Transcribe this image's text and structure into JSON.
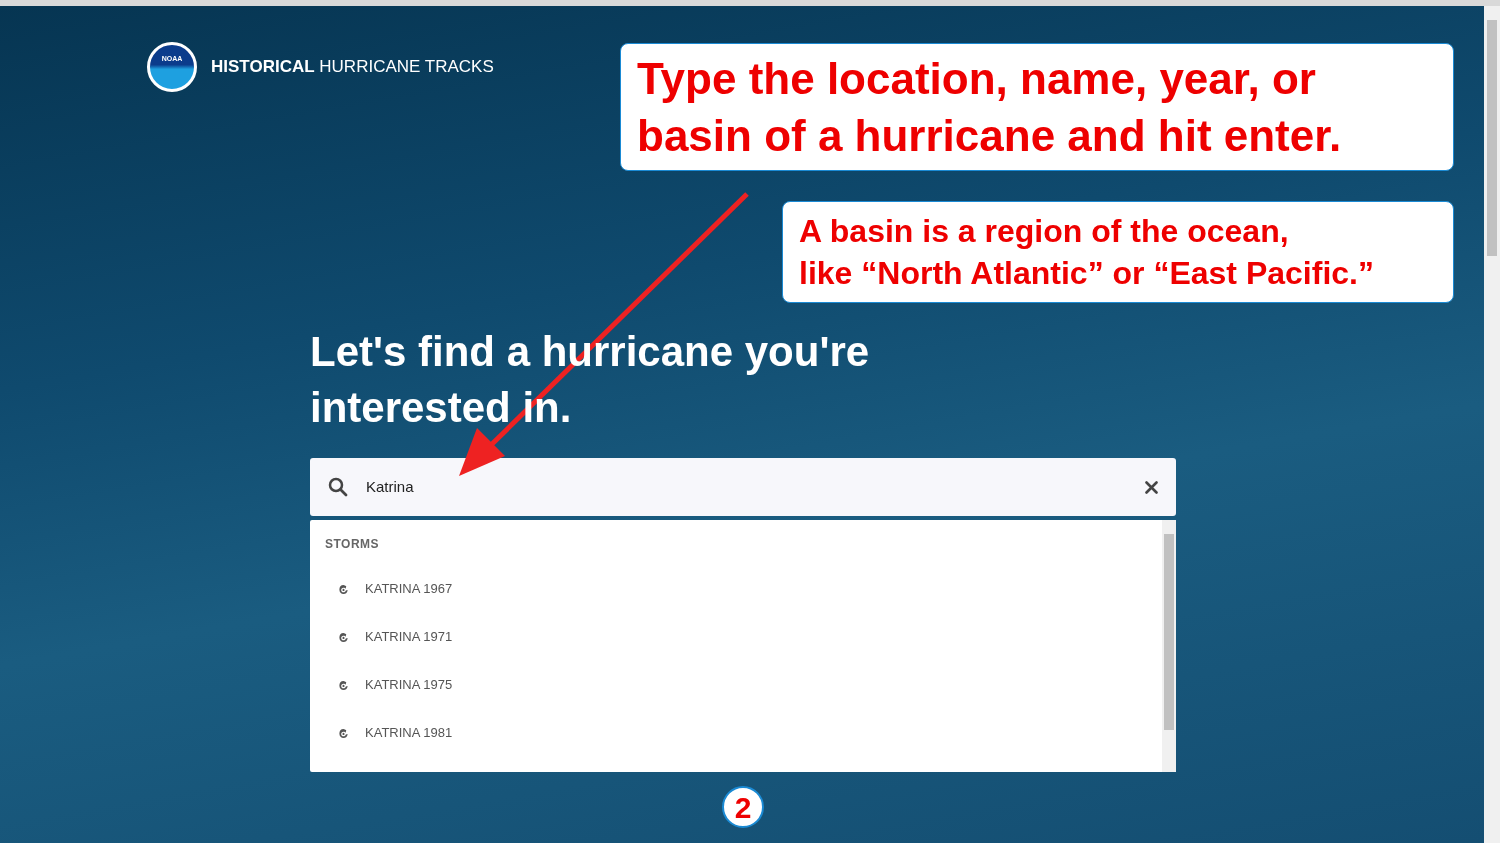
{
  "header": {
    "logo_text": "NOAA",
    "title_bold": "HISTORICAL",
    "title_rest": "HURRICANE TRACKS"
  },
  "heading": "Let's find a hurricane you're interested in.",
  "search": {
    "value": "Katrina"
  },
  "results": {
    "section": "STORMS",
    "items": [
      "KATRINA 1967",
      "KATRINA 1971",
      "KATRINA 1975",
      "KATRINA 1981"
    ]
  },
  "callouts": [
    {
      "lines": [
        "Type the location, name, year, or",
        "basin of a hurricane and hit enter."
      ]
    },
    {
      "lines": [
        "A basin is a region of the ocean,",
        "like “North Atlantic” or “East Pacific.”"
      ]
    }
  ],
  "step_number": "2"
}
